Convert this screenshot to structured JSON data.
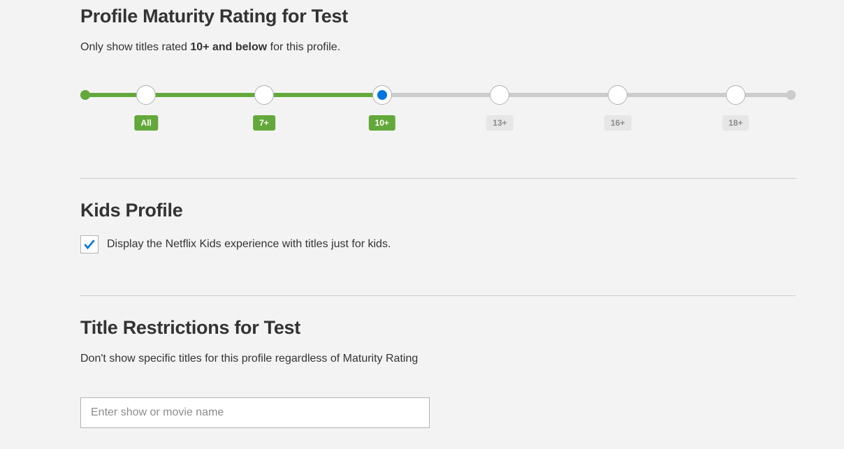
{
  "maturity": {
    "title": "Profile Maturity Rating for Test",
    "subtext_prefix": "Only show titles rated ",
    "subtext_bold": "10+ and below",
    "subtext_suffix": " for this profile.",
    "stops": [
      {
        "label": "All",
        "active": true,
        "selected": false
      },
      {
        "label": "7+",
        "active": true,
        "selected": false
      },
      {
        "label": "10+",
        "active": true,
        "selected": true
      },
      {
        "label": "13+",
        "active": false,
        "selected": false
      },
      {
        "label": "16+",
        "active": false,
        "selected": false
      },
      {
        "label": "18+",
        "active": false,
        "selected": false
      }
    ]
  },
  "kids": {
    "title": "Kids Profile",
    "checkbox_label": "Display the Netflix Kids experience with titles just for kids.",
    "checked": true
  },
  "restrictions": {
    "title": "Title Restrictions for Test",
    "subtext": "Don't show specific titles for this profile regardless of Maturity Rating",
    "placeholder": "Enter show or movie name"
  }
}
